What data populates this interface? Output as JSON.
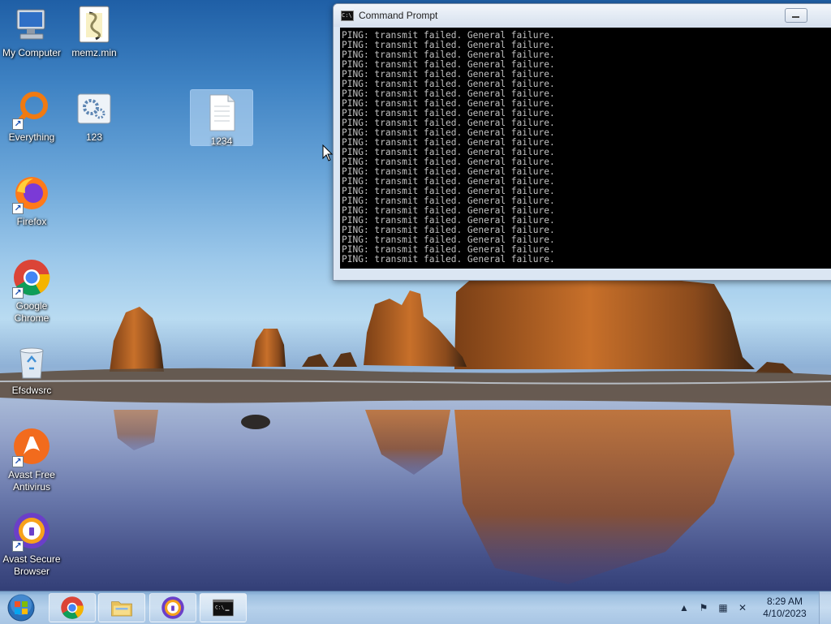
{
  "desktop": {
    "icons": [
      {
        "label": "My Computer",
        "icon": "computer-icon",
        "shortcut": false
      },
      {
        "label": "memz.min",
        "icon": "script-file-icon",
        "shortcut": false
      },
      {
        "label": "Everything",
        "icon": "everything-search-icon",
        "shortcut": true
      },
      {
        "label": "123",
        "icon": "settings-file-icon",
        "shortcut": false
      },
      {
        "label": "1234",
        "icon": "text-file-icon",
        "shortcut": false,
        "selected": true
      },
      {
        "label": "Firefox",
        "icon": "firefox-icon",
        "shortcut": true
      },
      {
        "label": "Google Chrome",
        "icon": "chrome-icon",
        "shortcut": true
      },
      {
        "label": "Efsdwsrc",
        "icon": "recycle-bin-icon",
        "shortcut": false
      },
      {
        "label": "Avast Free Antivirus",
        "icon": "avast-antivirus-icon",
        "shortcut": true
      },
      {
        "label": "Avast Secure Browser",
        "icon": "avast-browser-icon",
        "shortcut": true
      }
    ]
  },
  "cmd": {
    "title": "Command Prompt",
    "icon": "cmd-icon",
    "controls": {
      "minimize": "minimize-icon"
    },
    "lines": [
      "PING: transmit failed. General failure.",
      "PING: transmit failed. General failure.",
      "PING: transmit failed. General failure.",
      "PING: transmit failed. General failure.",
      "PING: transmit failed. General failure.",
      "PING: transmit failed. General failure.",
      "PING: transmit failed. General failure.",
      "PING: transmit failed. General failure.",
      "PING: transmit failed. General failure.",
      "PING: transmit failed. General failure.",
      "PING: transmit failed. General failure.",
      "PING: transmit failed. General failure.",
      "PING: transmit failed. General failure.",
      "PING: transmit failed. General failure.",
      "PING: transmit failed. General failure.",
      "PING: transmit failed. General failure.",
      "PING: transmit failed. General failure.",
      "PING: transmit failed. General failure.",
      "PING: transmit failed. General failure.",
      "PING: transmit failed. General failure.",
      "PING: transmit failed. General failure.",
      "PING: transmit failed. General failure.",
      "PING: transmit failed. General failure.",
      "PING: transmit failed. General failure."
    ],
    "colors": {
      "background": "#000000",
      "text": "#c0c0c0"
    }
  },
  "taskbar": {
    "start": "windows-start-orb-icon",
    "pinned": [
      {
        "name": "chrome",
        "icon": "chrome-icon"
      },
      {
        "name": "file-explorer",
        "icon": "folder-icon"
      },
      {
        "name": "avast-secure-browser",
        "icon": "avast-browser-icon"
      },
      {
        "name": "command-prompt",
        "icon": "cmd-icon",
        "active": true
      }
    ],
    "tray": {
      "icons": [
        "show-hidden-icons-icon",
        "action-center-flag-icon",
        "network-icon",
        "volume-muted-icon"
      ],
      "time": "8:29 AM",
      "date": "4/10/2023"
    }
  }
}
